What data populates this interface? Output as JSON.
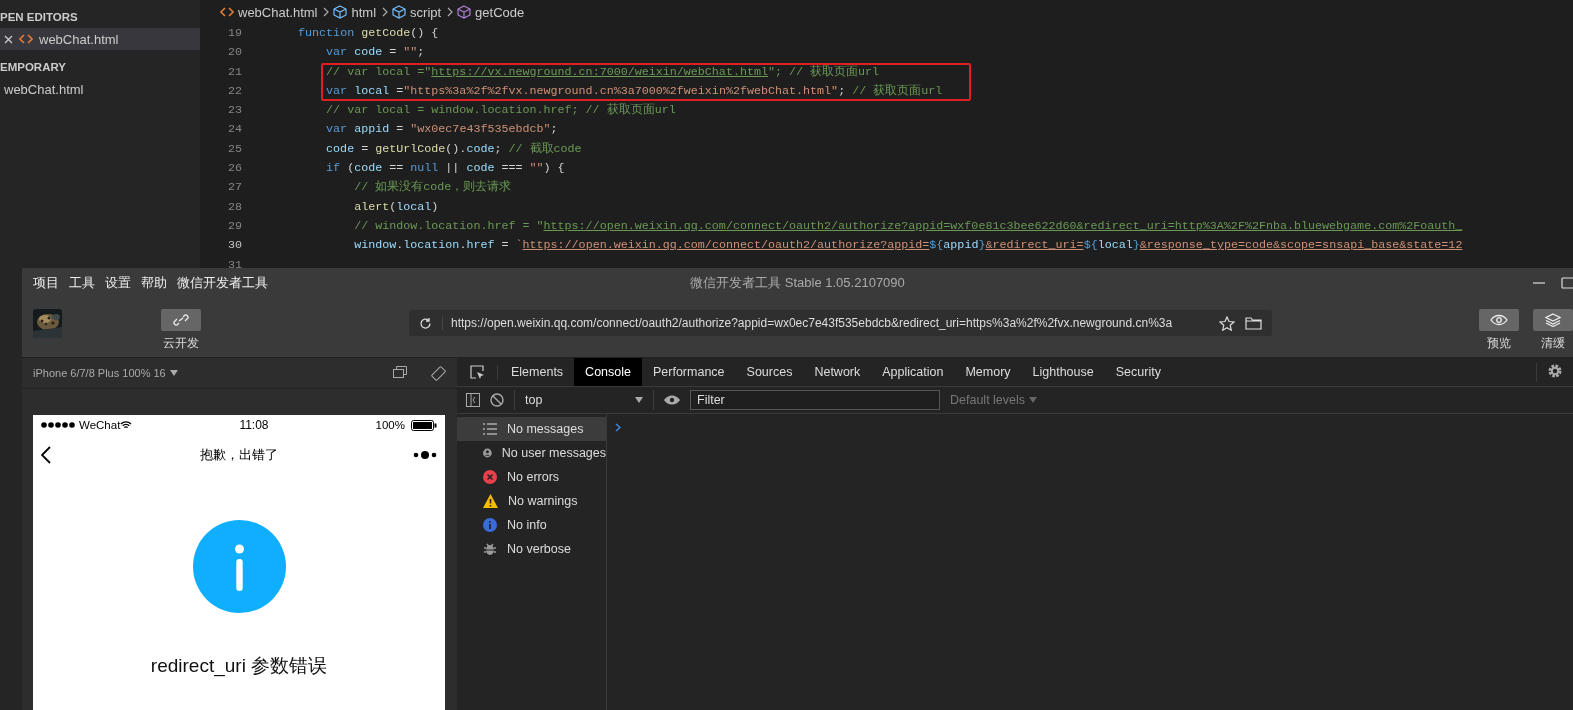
{
  "editor": {
    "sidebar": [
      {
        "title": "PEN EDITORS",
        "items": [
          {
            "label": "webChat.html",
            "selected": true,
            "closable": true
          }
        ]
      },
      {
        "title": "EMPORARY",
        "items": [
          {
            "label": "webChat.html",
            "selected": false,
            "closable": false
          }
        ]
      }
    ],
    "breadcrumb": [
      {
        "label": "webChat.html",
        "kind": "file"
      },
      {
        "label": "html",
        "kind": "element"
      },
      {
        "label": "script",
        "kind": "element"
      },
      {
        "label": "getCode",
        "kind": "method"
      }
    ],
    "code": [
      {
        "number": "19",
        "tokens": [
          {
            "text": "function",
            "kind": "kw"
          },
          {
            "text": " getCode",
            "kind": "fn"
          },
          {
            "text": "() {",
            "kind": "punc"
          }
        ],
        "children": [
          {
            "number": "20",
            "tokens": [
              {
                "text": "var",
                "kind": "kw"
              },
              {
                "text": " code",
                "kind": "var"
              },
              {
                "text": " = ",
                "kind": "punc"
              },
              {
                "text": "\"\"",
                "kind": "str"
              },
              {
                "text": ";",
                "kind": "punc"
              }
            ]
          },
          {
            "number": "21",
            "boxed": true,
            "tokens": [
              {
                "text": "// var local =\"",
                "kind": "cmt"
              },
              {
                "text": "https://vx.newground.cn:7000/weixin/webChat.html",
                "kind": "cmtlink"
              },
              {
                "text": "\"; // 获取页面url",
                "kind": "cmt"
              }
            ]
          },
          {
            "number": "22",
            "boxed": true,
            "tokens": [
              {
                "text": "var",
                "kind": "kw"
              },
              {
                "text": " local",
                "kind": "var"
              },
              {
                "text": " =",
                "kind": "punc"
              },
              {
                "text": "\"https%3a%2f%2fvx.newground.cn%3a7000%2fweixin%2fwebChat.html\"",
                "kind": "str"
              },
              {
                "text": ";",
                "kind": "punc"
              },
              {
                "text": " // 获取页面url",
                "kind": "cmt"
              }
            ]
          },
          {
            "number": "23",
            "tokens": [
              {
                "text": "// var local = window.location.href; // 获取页面url",
                "kind": "cmt"
              }
            ]
          },
          {
            "number": "24",
            "tokens": [
              {
                "text": "var",
                "kind": "kw"
              },
              {
                "text": " appid",
                "kind": "var"
              },
              {
                "text": " = ",
                "kind": "punc"
              },
              {
                "text": "\"wx0ec7e43f535ebdcb\"",
                "kind": "str"
              },
              {
                "text": ";",
                "kind": "punc"
              }
            ]
          },
          {
            "number": "25",
            "tokens": [
              {
                "text": "code",
                "kind": "var"
              },
              {
                "text": " = ",
                "kind": "punc"
              },
              {
                "text": "getUrlCode",
                "kind": "fn"
              },
              {
                "text": "().",
                "kind": "punc"
              },
              {
                "text": "code",
                "kind": "var"
              },
              {
                "text": "; ",
                "kind": "punc"
              },
              {
                "text": "// 截取code",
                "kind": "cmt"
              }
            ]
          },
          {
            "number": "26",
            "tokens": [
              {
                "text": "if",
                "kind": "kw"
              },
              {
                "text": " (",
                "kind": "punc"
              },
              {
                "text": "code",
                "kind": "var"
              },
              {
                "text": " == ",
                "kind": "punc"
              },
              {
                "text": "null",
                "kind": "kw"
              },
              {
                "text": " || ",
                "kind": "punc"
              },
              {
                "text": "code",
                "kind": "var"
              },
              {
                "text": " === ",
                "kind": "punc"
              },
              {
                "text": "\"\"",
                "kind": "str"
              },
              {
                "text": ") {",
                "kind": "punc"
              }
            ],
            "children": [
              {
                "number": "27",
                "tokens": [
                  {
                    "text": "// 如果没有code，则去请求",
                    "kind": "cmt"
                  }
                ]
              },
              {
                "number": "28",
                "tokens": [
                  {
                    "text": "alert",
                    "kind": "fn"
                  },
                  {
                    "text": "(",
                    "kind": "punc"
                  },
                  {
                    "text": "local",
                    "kind": "var"
                  },
                  {
                    "text": ")",
                    "kind": "punc"
                  }
                ]
              },
              {
                "number": "29",
                "tokens": [
                  {
                    "text": "// window.location.href = \"",
                    "kind": "cmt"
                  },
                  {
                    "text": "https://open.weixin.qq.com/connect/oauth2/authorize?appid=wxf0e81c3bee622d60&redirect_uri=http%3A%2F%2Fnba.bluewebgame.com%2Foauth_",
                    "kind": "cmtlink"
                  }
                ]
              },
              {
                "number": "30",
                "current": true,
                "tokens": [
                  {
                    "text": "window",
                    "kind": "var"
                  },
                  {
                    "text": ".",
                    "kind": "punc"
                  },
                  {
                    "text": "location",
                    "kind": "var"
                  },
                  {
                    "text": ".",
                    "kind": "punc"
                  },
                  {
                    "text": "href",
                    "kind": "var"
                  },
                  {
                    "text": " = ",
                    "kind": "punc"
                  },
                  {
                    "text": "`",
                    "kind": "str"
                  },
                  {
                    "text": "https://open.weixin.qq.com/connect/oauth2/authorize?appid=",
                    "kind": "strlink"
                  },
                  {
                    "text": "${",
                    "kind": "kw"
                  },
                  {
                    "text": "appid",
                    "kind": "var"
                  },
                  {
                    "text": "}",
                    "kind": "kw"
                  },
                  {
                    "text": "&redirect_uri=",
                    "kind": "strlink"
                  },
                  {
                    "text": "${",
                    "kind": "kw"
                  },
                  {
                    "text": "local",
                    "kind": "var"
                  },
                  {
                    "text": "}",
                    "kind": "kw"
                  },
                  {
                    "text": "&response_type=code&scope=snsapi_base&state=12",
                    "kind": "strlink"
                  }
                ]
              },
              {
                "number": "31"
              }
            ]
          }
        ]
      }
    ]
  },
  "devtools_window": {
    "menu": [
      "项目",
      "工具",
      "设置",
      "帮助",
      "微信开发者工具"
    ],
    "title": "微信开发者工具 Stable 1.05.2107090",
    "toolbar": {
      "left_buttons": [
        {
          "label": "云开发",
          "kind": "cloud"
        }
      ],
      "address": "https://open.weixin.qq.com/connect/oauth2/authorize?appid=wx0ec7e43f535ebdcb&redirect_uri=https%3a%2f%2fvx.newground.cn%3a",
      "right_buttons": [
        {
          "label": "预览",
          "kind": "preview"
        },
        {
          "label": "清缓",
          "kind": "cache"
        }
      ]
    },
    "simulator": {
      "device": "iPhone 6/7/8 Plus 100% 16",
      "status": {
        "carrier": "WeChat",
        "time": "11:08",
        "battery": "100%"
      },
      "nav_title": "抱歉，出错了",
      "message": "redirect_uri 参数错误"
    },
    "devtools": {
      "tabs": [
        {
          "label": "Elements",
          "selected": false
        },
        {
          "label": "Console",
          "selected": true
        },
        {
          "label": "Performance",
          "selected": false
        },
        {
          "label": "Sources",
          "selected": false
        },
        {
          "label": "Network",
          "selected": false
        },
        {
          "label": "Application",
          "selected": false
        },
        {
          "label": "Memory",
          "selected": false
        },
        {
          "label": "Lighthouse",
          "selected": false
        },
        {
          "label": "Security",
          "selected": false
        }
      ],
      "context": "top",
      "filter_placeholder": "Filter",
      "levels": "Default levels",
      "sidebar": [
        {
          "label": "No messages",
          "kind": "messages",
          "selected": true
        },
        {
          "label": "No user messages",
          "kind": "user",
          "selected": false
        },
        {
          "label": "No errors",
          "kind": "error",
          "selected": false
        },
        {
          "label": "No warnings",
          "kind": "warning",
          "selected": false
        },
        {
          "label": "No info",
          "kind": "info",
          "selected": false
        },
        {
          "label": "No verbose",
          "kind": "verbose",
          "selected": false
        }
      ]
    }
  }
}
